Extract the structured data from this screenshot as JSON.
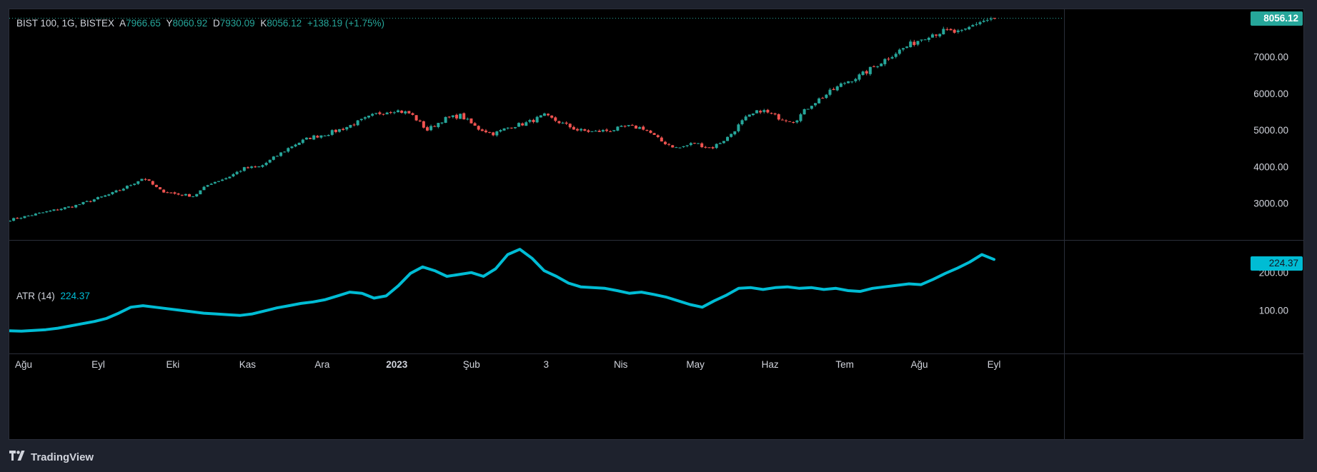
{
  "legend": {
    "symbol": "BIST 100, 1G, BISTEX",
    "open_label": "A",
    "open_value": "7966.65",
    "high_label": "Y",
    "high_value": "8060.92",
    "low_label": "D",
    "low_value": "7930.09",
    "close_label": "K",
    "close_value": "8056.12",
    "change": "+138.19 (+1.75%)"
  },
  "atr_legend": {
    "name": "ATR (14)",
    "value": "224.37"
  },
  "price_tag": "8056.12",
  "atr_tag": "224.37",
  "footer": {
    "brand": "TradingView"
  },
  "colors": {
    "up": "#26a69a",
    "down": "#ef5350",
    "atr": "#00bcd4",
    "background": "#000000",
    "frame": "#1e222d",
    "text": "#d1d4dc"
  },
  "icons": [
    "tradingview-logo-icon"
  ],
  "chart_data": [
    {
      "type": "candlestick",
      "title": "BIST 100, 1G, BISTEX",
      "y_ticks": [
        "3000.00",
        "4000.00",
        "5000.00",
        "6000.00",
        "7000.00"
      ],
      "ylim": [
        2000,
        8300
      ],
      "x_ticks": [
        "Ağu",
        "Eyl",
        "Eki",
        "Kas",
        "Ara",
        "2023",
        "Şub",
        "3",
        "Nis",
        "May",
        "Haz",
        "Tem",
        "Ağu",
        "Eyl"
      ],
      "last_close": 8056.12,
      "close_anchors": [
        2550,
        2650,
        2750,
        2850,
        2950,
        3100,
        3250,
        3450,
        3700,
        3350,
        3250,
        3200,
        3550,
        3700,
        3950,
        4000,
        4300,
        4600,
        4800,
        4900,
        5050,
        5250,
        5450,
        5550,
        5450,
        5000,
        5300,
        5400,
        5050,
        4900,
        5100,
        5200,
        5400,
        5200,
        5000,
        4950,
        5000,
        5100,
        5050,
        4700,
        4500,
        4650,
        4500,
        4800,
        5300,
        5550,
        5350,
        5250,
        5700,
        6000,
        6300,
        6500,
        6800,
        7100,
        7350,
        7600,
        7700,
        7650,
        7950,
        8056.12
      ]
    },
    {
      "type": "line",
      "title": "ATR (14)",
      "series": [
        {
          "name": "ATR (14)",
          "values": [
            45,
            44,
            46,
            48,
            52,
            58,
            64,
            70,
            78,
            92,
            108,
            112,
            108,
            104,
            100,
            96,
            92,
            90,
            88,
            86,
            90,
            98,
            106,
            112,
            118,
            122,
            128,
            138,
            148,
            145,
            132,
            138,
            165,
            198,
            215,
            205,
            190,
            195,
            200,
            190,
            210,
            248,
            262,
            238,
            205,
            190,
            172,
            162,
            160,
            158,
            152,
            145,
            148,
            142,
            135,
            125,
            115,
            108,
            125,
            140,
            158,
            160,
            155,
            160,
            162,
            158,
            160,
            155,
            158,
            152,
            150,
            158,
            162,
            166,
            170,
            168,
            182,
            198,
            212,
            228,
            248,
            235
          ]
        }
      ],
      "y_ticks": [
        "100.00",
        "200.00"
      ],
      "ylim": [
        0,
        285
      ],
      "last_value": 224.37
    }
  ]
}
